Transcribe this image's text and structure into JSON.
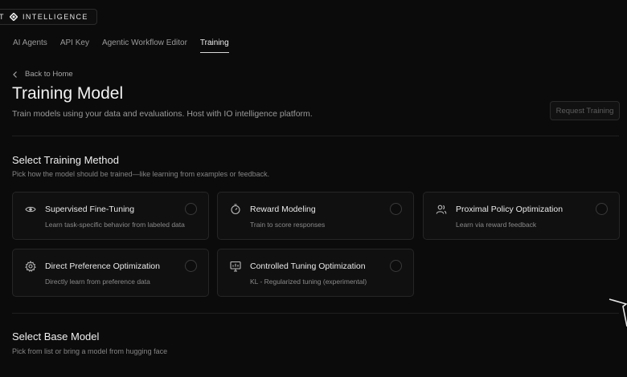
{
  "brand": {
    "left_text": "T",
    "right_text": "INTELLIGENCE",
    "logo_icon": "diamond-logo-icon"
  },
  "nav": {
    "tabs": [
      {
        "label": "AI Agents",
        "active": false
      },
      {
        "label": "API Key",
        "active": false
      },
      {
        "label": "Agentic Workflow Editor",
        "active": false
      },
      {
        "label": "Training",
        "active": true
      }
    ]
  },
  "back_link": {
    "label": "Back to Home",
    "icon": "chevron-left-icon"
  },
  "header": {
    "title": "Training Model",
    "subtitle": "Train models using your data and evaluations. Host with IO intelligence platform.",
    "request_button": "Request Training"
  },
  "training_method": {
    "title": "Select Training Method",
    "subtitle": "Pick how the model should be trained—like learning from examples or feedback.",
    "cards": [
      {
        "title": "Supervised Fine-Tuning",
        "description": "Learn task-specific behavior from labeled data",
        "icon": "eye-icon"
      },
      {
        "title": "Reward Modeling",
        "description": "Train to score responses",
        "icon": "timer-icon"
      },
      {
        "title": "Proximal Policy Optimization",
        "description": "Learn via reward feedback",
        "icon": "users-icon"
      },
      {
        "title": "Direct Preference Optimization",
        "description": "Directly learn from preference data",
        "icon": "gear-icon"
      },
      {
        "title": "Controlled Tuning Optimization",
        "description": "KL - Regularized tuning (experimental)",
        "icon": "chart-icon"
      }
    ]
  },
  "base_model": {
    "title": "Select Base Model",
    "subtitle": "Pick from list or bring a model from hugging face"
  }
}
